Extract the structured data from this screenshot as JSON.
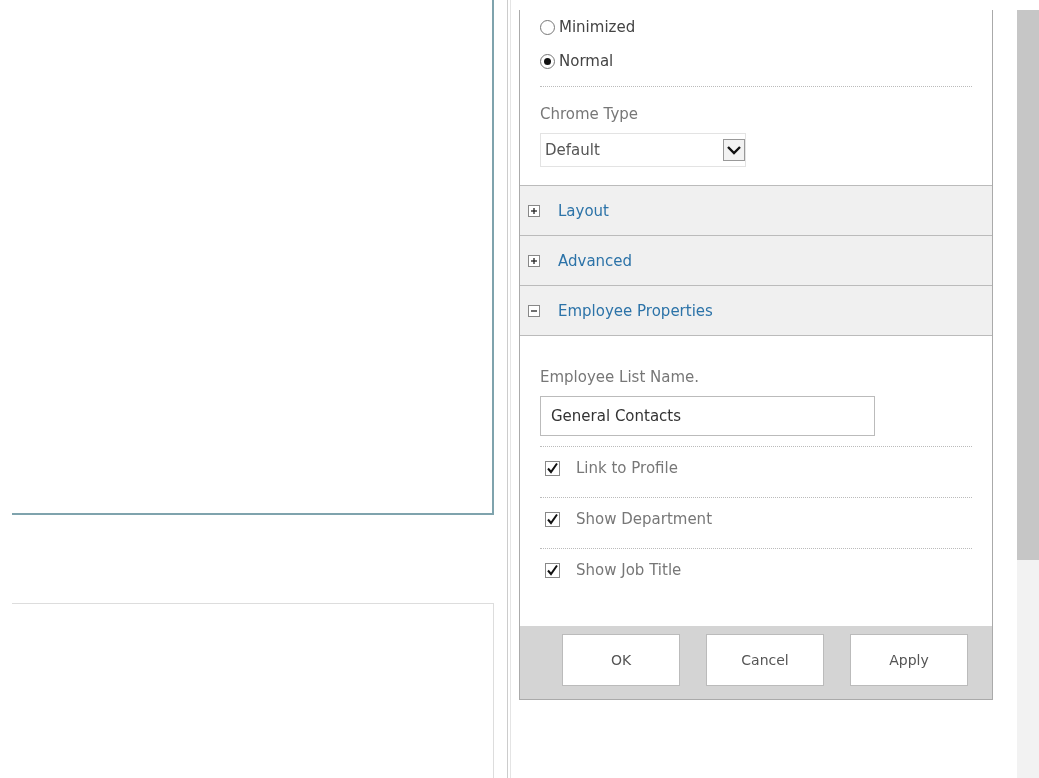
{
  "display_mode": [
    {
      "label": "Minimized",
      "selected": false
    },
    {
      "label": "Normal",
      "selected": true
    }
  ],
  "chrome_type": {
    "label": "Chrome Type",
    "value": "Default"
  },
  "sections": [
    {
      "title": "Layout",
      "expanded": false
    },
    {
      "title": "Advanced",
      "expanded": false
    },
    {
      "title": "Employee Properties",
      "expanded": true
    }
  ],
  "employee_list": {
    "label": "Employee List Name.",
    "value": "General Contacts"
  },
  "options": [
    {
      "label": "Link to Profile",
      "checked": true
    },
    {
      "label": "Show Department",
      "checked": true
    },
    {
      "label": "Show Job Title",
      "checked": true
    }
  ],
  "buttons": [
    "OK",
    "Cancel",
    "Apply"
  ]
}
